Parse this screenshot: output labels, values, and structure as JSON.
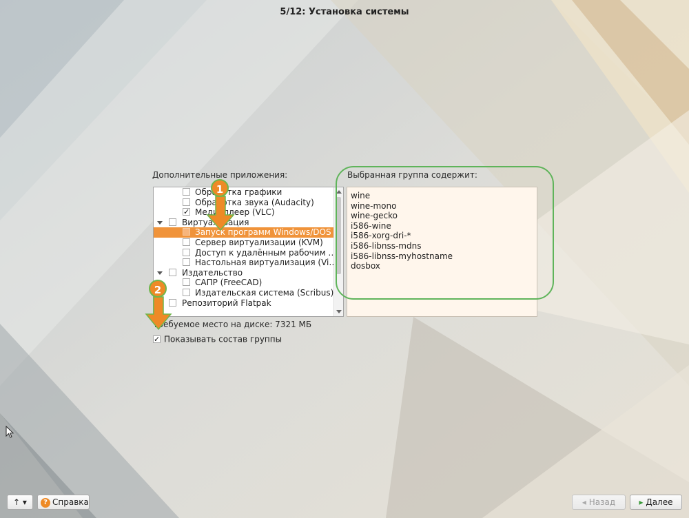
{
  "window": {
    "title": "5/12: Установка системы"
  },
  "left_panel": {
    "label": "Дополнительные приложения:",
    "items": [
      {
        "label": "Обработка графики",
        "checked": false,
        "level": 1,
        "selected": false
      },
      {
        "label": "Обработка звука (Audacity)",
        "checked": false,
        "level": 1,
        "selected": false
      },
      {
        "label": "Медиаплеер (VLC)",
        "checked": true,
        "level": 1,
        "selected": false
      },
      {
        "label": "Виртуализация",
        "checked": false,
        "level": 0,
        "expanded": true,
        "selected": false
      },
      {
        "label": "Запуск программ Windows/DOS",
        "checked": false,
        "level": 1,
        "selected": true
      },
      {
        "label": "Сервер виртуализации (KVM)",
        "checked": false,
        "level": 1,
        "selected": false
      },
      {
        "label": "Доступ к удалённым рабочим …",
        "checked": false,
        "level": 1,
        "selected": false
      },
      {
        "label": "Настольная виртуализация (Vi…",
        "checked": false,
        "level": 1,
        "selected": false
      },
      {
        "label": "Издательство",
        "checked": false,
        "level": 0,
        "expanded": true,
        "selected": false
      },
      {
        "label": "САПР (FreeCAD)",
        "checked": false,
        "level": 1,
        "selected": false
      },
      {
        "label": "Издательская система (Scribus)",
        "checked": false,
        "level": 1,
        "selected": false
      },
      {
        "label": "Репозиторий Flatpak",
        "checked": false,
        "level": 0,
        "selected": false
      }
    ],
    "disk_space": "Требуемое место на диске: 7321 МБ",
    "show_group": {
      "label": "Показывать состав группы",
      "checked": true
    }
  },
  "right_panel": {
    "label": "Выбранная группа содержит:",
    "packages": [
      "wine",
      "wine-mono",
      "wine-gecko",
      "i586-wine",
      "i586-xorg-dri-*",
      "i586-libnss-mdns",
      "i586-libnss-myhostname",
      "dosbox"
    ]
  },
  "annotations": {
    "badge1": "1",
    "badge2": "2"
  },
  "footer": {
    "menu_button": "↑ ▾",
    "help_label": "Справка",
    "back_label": "Назад",
    "next_label": "Далее"
  },
  "colors": {
    "accent": "#f0933a",
    "highlight_ring": "#5fb45a"
  }
}
